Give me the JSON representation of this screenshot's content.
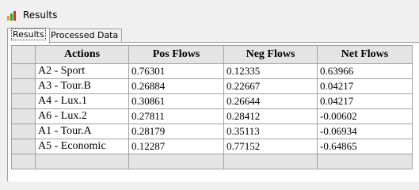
{
  "window": {
    "title": "Results",
    "icon": "bar-chart-icon"
  },
  "tabs": [
    {
      "label": "Results",
      "active": true
    },
    {
      "label": "Processed Data",
      "active": false
    }
  ],
  "table": {
    "columns": [
      "Actions",
      "Pos Flows",
      "Neg Flows",
      "Net Flows"
    ],
    "rows": [
      {
        "action": "A2 - Sport",
        "pos": "0.76301",
        "neg": "0.12335",
        "net": "0.63966"
      },
      {
        "action": "A3 - Tour.B",
        "pos": "0.26884",
        "neg": "0.22667",
        "net": "0.04217"
      },
      {
        "action": "A4 - Lux.1",
        "pos": "0.30861",
        "neg": "0.26644",
        "net": "0.04217"
      },
      {
        "action": "A6 - Lux.2",
        "pos": "0.27811",
        "neg": "0.28412",
        "net": "-0.00602"
      },
      {
        "action": "A1 - Tour.A",
        "pos": "0.28179",
        "neg": "0.35113",
        "net": "-0.06934"
      },
      {
        "action": "A5 - Economic",
        "pos": "0.12287",
        "neg": "0.77152",
        "net": "-0.64865"
      }
    ]
  },
  "colors": {
    "icon_bar_1": "#e8a020",
    "icon_bar_2": "#30a030",
    "icon_bar_3": "#d03020",
    "header_bg": "#e4e4e4",
    "grid_line": "#a0a0a0"
  }
}
